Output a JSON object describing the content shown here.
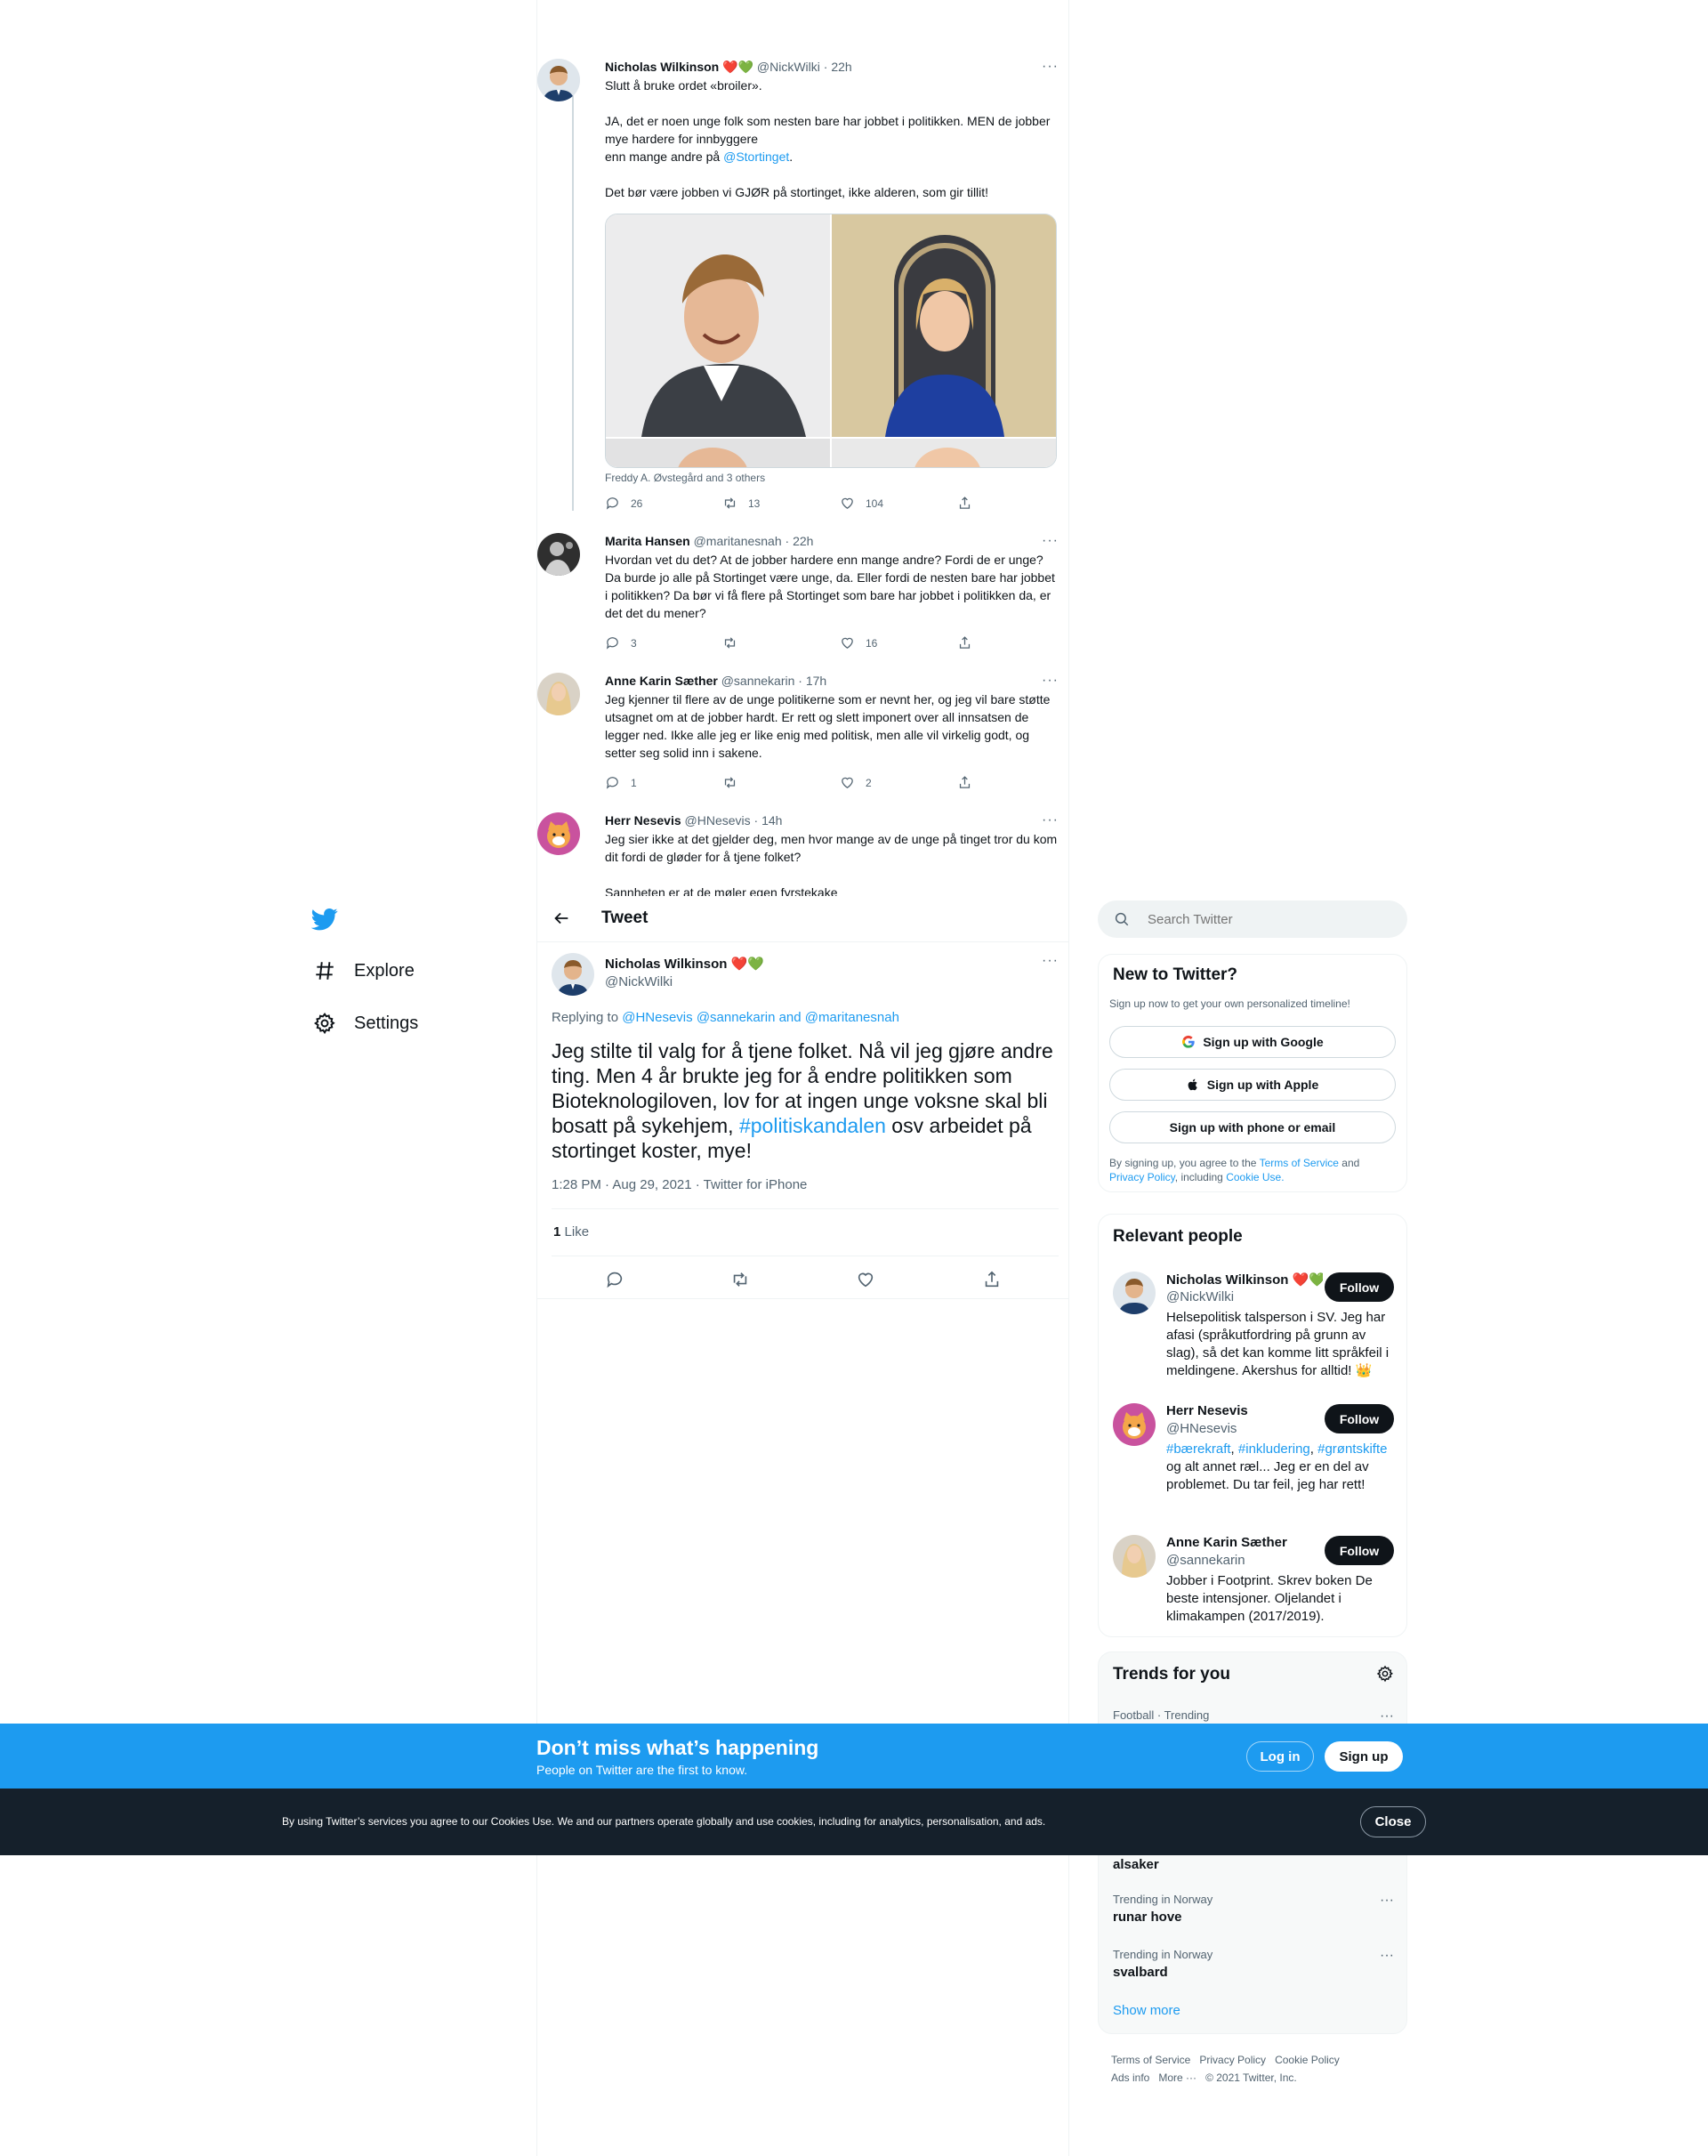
{
  "nav": {
    "explore": "Explore",
    "settings": "Settings"
  },
  "header": {
    "title": "Tweet"
  },
  "thread": [
    {
      "name": "Nicholas Wilkinson",
      "emoji": "❤️💚",
      "handle": "@NickWilki",
      "time": "22h",
      "lines": [
        "Slutt å bruke ordet «broiler».",
        "",
        "JA, det er noen unge folk som nesten bare har jobbet i politikken. MEN de jobber mye hardere for innbyggere",
        "enn mange andre på"
      ],
      "mention": "@Stortinget",
      "mention_after": ".",
      "last_line": "Det bør være jobben vi GJØR på stortinget, ikke alderen, som gir tillit!",
      "media_caption": "Freddy A. Øvstegård and 3 others",
      "replies": "26",
      "retweets": "13",
      "likes": "104"
    },
    {
      "name": "Marita Hansen",
      "handle": "@maritanesnah",
      "time": "22h",
      "text": "Hvordan vet du det? At de jobber hardere enn mange andre? Fordi de er unge? Da burde jo alle på Stortinget være unge, da. Eller fordi de nesten bare har jobbet i politikken? Da bør vi få flere på Stortinget som bare har jobbet i politikken da, er det det du mener?",
      "replies": "3",
      "retweets": "",
      "likes": "16"
    },
    {
      "name": "Anne Karin Sæther",
      "handle": "@sannekarin",
      "time": "17h",
      "text": "Jeg kjenner til flere av de unge politikerne som er nevnt her, og jeg vil bare støtte utsagnet om at de jobber hardt. Er rett og slett imponert over all innsatsen de legger ned. Ikke alle jeg er like enig med politisk, men alle vil virkelig godt, og setter seg solid inn i sakene.",
      "replies": "1",
      "retweets": "",
      "likes": "2"
    },
    {
      "name": "Herr Nesevis",
      "handle": "@HNesevis",
      "time": "14h",
      "text": "Jeg sier ikke at det gjelder deg, men hvor mange av de unge på tinget tror du kom dit fordi de gløder for å tjene folket?",
      "text2": "Sannheten er at de møler egen fyrstekake"
    }
  ],
  "main_tweet": {
    "name": "Nicholas Wilkinson",
    "emoji": "❤️💚",
    "handle": "@NickWilki",
    "replying_prefix": "Replying to",
    "replying_to_1": "@HNesevis",
    "replying_to_2": "@sannekarin",
    "replying_and": "and",
    "replying_to_3": "@maritanesnah",
    "text_before": "Jeg stilte til valg for å tjene folket. Nå vil jeg gjøre andre ting. Men 4 år brukte jeg for å endre politikken som Bioteknologiloven, lov for at ingen unge voksne skal bli bosatt på sykehjem,",
    "hashtag": "#politiskandalen",
    "text_after": "osv arbeidet på stortinget koster, mye!",
    "meta": "1:28 PM · Aug 29, 2021 · Twitter for iPhone",
    "likes_count": "1",
    "likes_label": "Like"
  },
  "search": {
    "placeholder": "Search Twitter"
  },
  "signup": {
    "title": "New to Twitter?",
    "subtitle": "Sign up now to get your own personalized timeline!",
    "google": "Sign up with Google",
    "apple": "Sign up with Apple",
    "phone": "Sign up with phone or email",
    "terms_prefix": "By signing up, you agree to the",
    "terms": "Terms of Service",
    "and": "and",
    "privacy": "Privacy Policy",
    "including": ", including",
    "cookie": "Cookie Use."
  },
  "relevant": {
    "title": "Relevant people",
    "follow_label": "Follow",
    "people": [
      {
        "name": "Nicholas Wilkinson ❤️💚",
        "handle": "@NickWilki",
        "bio": "Helsepolitisk talsperson i SV. Jeg har afasi (språkutfordring på grunn av slag), så det kan komme litt språkfeil i meldingene. Akershus for alltid! 👑"
      },
      {
        "name": "Herr Nesevis",
        "handle": "@HNesevis",
        "bio_tag1": "#bærekraft",
        "bio_tag2": "#inkludering",
        "bio_tag3": "#grøntskifte",
        "bio_rest": "og alt annet ræl... Jeg er en del av problemet. Du tar feil, jeg har rett!"
      },
      {
        "name": "Anne Karin Sæther",
        "handle": "@sannekarin",
        "bio": "Jobber i Footprint. Skrev boken De beste intensjoner. Oljelandet i klimakampen (2017/2019)."
      }
    ]
  },
  "trends": {
    "title": "Trends for you",
    "items": [
      {
        "meta": "Football · Trending",
        "name": ""
      },
      {
        "meta": "",
        "name": "alsaker"
      },
      {
        "meta": "Trending in Norway",
        "name": "runar hove"
      },
      {
        "meta": "Trending in Norway",
        "name": "svalbard"
      }
    ],
    "show_more": "Show more"
  },
  "footer": {
    "terms": "Terms of Service",
    "privacy": "Privacy Policy",
    "cookie": "Cookie Policy",
    "ads": "Ads info",
    "more": "More ···",
    "copyright": "© 2021 Twitter, Inc."
  },
  "banner": {
    "title": "Don’t miss what’s happening",
    "subtitle": "People on Twitter are the first to know.",
    "login": "Log in",
    "signup": "Sign up"
  },
  "cookie_bar": {
    "text": "By using Twitter’s services you agree to our Cookies Use. We and our partners operate globally and use cookies, including for analytics, personalisation, and ads.",
    "close": "Close"
  },
  "colors": {
    "accent": "#1d9bf0",
    "dark": "#0f1419",
    "muted": "#536471",
    "cookie_bg": "#15202b"
  }
}
